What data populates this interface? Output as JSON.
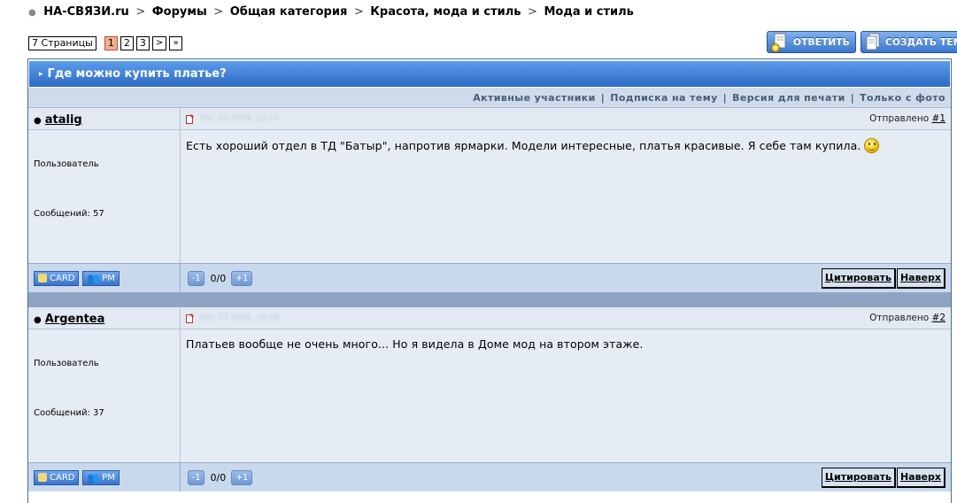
{
  "breadcrumb": [
    "НА-СВЯЗИ.ru",
    "Форумы",
    "Общая категория",
    "Красота, мода и стиль",
    "Мода и стиль"
  ],
  "breadcrumb_sep": ">",
  "pager": {
    "total_label": "7 Страницы",
    "pages": [
      "1",
      "2",
      "3"
    ],
    "current": "1",
    "next": ">",
    "last": "»"
  },
  "buttons": {
    "reply": "ОТВЕТИТЬ",
    "new_topic": "СОЗДАТЬ ТЕМУ"
  },
  "topic": {
    "title": "Где можно купить платье?"
  },
  "topic_options": [
    "Активные участники",
    "Подписка на тему",
    "Версия для печати",
    "Только с фото"
  ],
  "posts": [
    {
      "author": "atalig",
      "date": "Dec 12 2008, 22:24",
      "sent_label": "Отправлено",
      "number": "#1",
      "role": "Пользователь",
      "messages_label": "Сообщений: 57",
      "text": "Есть хороший отдел в ТД \"Батыр\", напротив ярмарки. Модели интересные, платья красивые. Я себе там купила.",
      "votes": "0/0",
      "vote_minus": "-1",
      "vote_plus": "+1",
      "card": "CARD",
      "pm": "PM",
      "quote": "Цитировать",
      "up": "Наверх"
    },
    {
      "author": "Argentea",
      "date": "Dec 13 2008, 18:08",
      "sent_label": "Отправлено",
      "number": "#2",
      "role": "Пользователь",
      "messages_label": "Сообщений: 37",
      "text": "Платьев вообще не очень много... Но я видела в Доме мод на втором этаже.",
      "votes": "0/0",
      "vote_minus": "-1",
      "vote_plus": "+1",
      "card": "CARD",
      "pm": "PM",
      "quote": "Цитировать",
      "up": "Наверх"
    }
  ],
  "colors": {
    "header_blue": "#2e6bc5",
    "post_bg": "#e6ecf4",
    "footer_bg": "#c9d9ec",
    "current_page": "#f4ae8f"
  }
}
